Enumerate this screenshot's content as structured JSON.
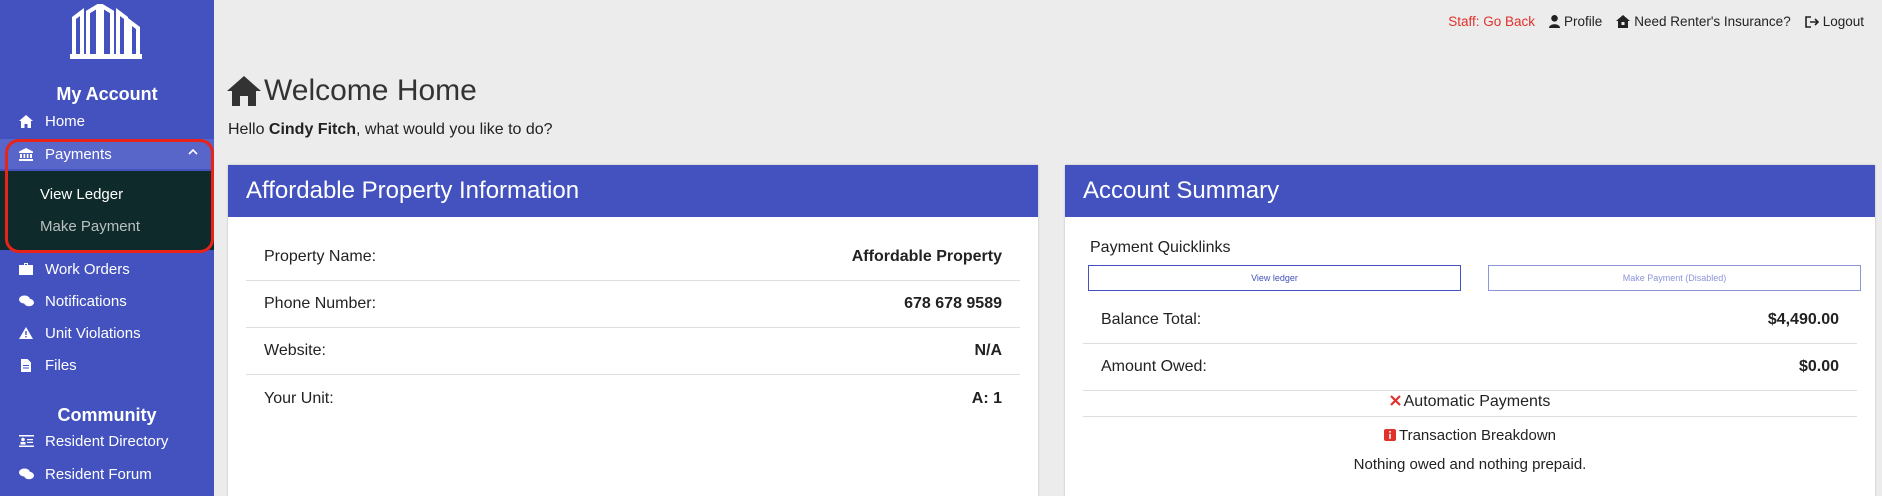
{
  "sidebar": {
    "my_account_title": "My Account",
    "items": [
      {
        "label": "Home",
        "icon": "home-icon"
      },
      {
        "label": "Payments",
        "icon": "bank-icon"
      },
      {
        "label": "Work Orders",
        "icon": "toolbox-icon"
      },
      {
        "label": "Notifications",
        "icon": "chat-bubbles-icon"
      },
      {
        "label": "Unit Violations",
        "icon": "warning-icon"
      },
      {
        "label": "Files",
        "icon": "file-icon"
      }
    ],
    "payments_submenu": [
      {
        "label": "View Ledger"
      },
      {
        "label": "Make Payment"
      }
    ],
    "community_title": "Community",
    "community_items": [
      {
        "label": "Resident Directory",
        "icon": "directory-icon"
      },
      {
        "label": "Resident Forum",
        "icon": "chat-bubbles-icon"
      }
    ]
  },
  "topbar": {
    "staff_link": "Staff: Go Back",
    "profile": "Profile",
    "insurance": "Need Renter's Insurance?",
    "logout": "Logout"
  },
  "page": {
    "title": "Welcome Home",
    "hello_prefix": "Hello ",
    "user_name": "Cindy Fitch",
    "hello_suffix": ", what would you like to do?"
  },
  "property_card": {
    "title": "Affordable Property Information",
    "rows": [
      {
        "label": "Property Name:",
        "value": "Affordable Property"
      },
      {
        "label": "Phone Number:",
        "value": "678 678 9589"
      },
      {
        "label": "Website:",
        "value": "N/A"
      },
      {
        "label": "Your Unit:",
        "value": "A: 1"
      }
    ]
  },
  "account_card": {
    "title": "Account Summary",
    "quicklinks_title": "Payment Quicklinks",
    "view_ledger_btn": "View ledger",
    "make_payment_btn": "Make Payment (Disabled)",
    "rows": [
      {
        "label": "Balance Total:",
        "value": "$4,490.00"
      },
      {
        "label": "Amount Owed:",
        "value": "$0.00"
      }
    ],
    "automatic_payments": "Automatic Payments",
    "transaction_breakdown": "Transaction Breakdown",
    "nothing_owed": "Nothing owed and nothing prepaid."
  },
  "colors": {
    "brand": "#4352bf",
    "submenu_bg": "#0f2a2a",
    "staff_link": "#e0312b",
    "highlight": "#e8231a"
  }
}
